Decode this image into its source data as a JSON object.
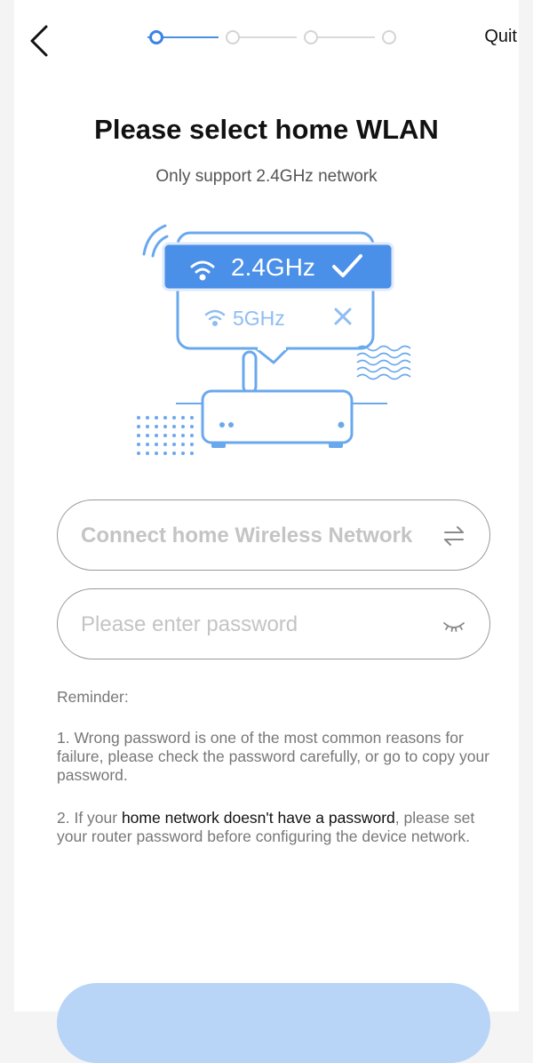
{
  "header": {
    "quit_label": "Quit",
    "steps": [
      {
        "active": true
      },
      {
        "active": false
      },
      {
        "active": false
      },
      {
        "active": false
      }
    ]
  },
  "main": {
    "title": "Please select home WLAN",
    "subtitle": "Only support 2.4GHz network",
    "illustration": {
      "band_supported": "2.4GHz",
      "band_unsupported": "5GHz"
    }
  },
  "form": {
    "network_field": {
      "value": "Connect home Wireless Network"
    },
    "password_field": {
      "placeholder": "Please enter password"
    }
  },
  "reminder": {
    "heading": "Reminder:",
    "item1": "1. Wrong password is one of the most common reasons for failure, please check the password carefully, or go to copy your password.",
    "item2_prefix": "2. If your ",
    "item2_highlight": "home network doesn't have a password",
    "item2_suffix": ", please set your router password before configuring the device network."
  },
  "colors": {
    "accent": "#3a84e6",
    "illustration_blue": "#6aa8ee",
    "button_disabled": "#b8d4f7"
  }
}
